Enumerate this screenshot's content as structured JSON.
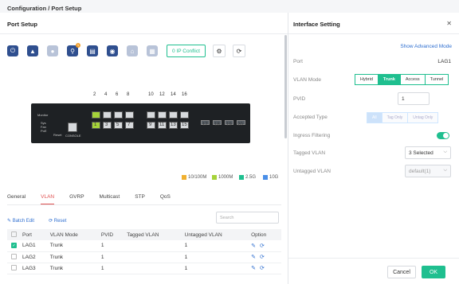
{
  "breadcrumb": {
    "root": "Configuration /",
    "current": "Port Setup"
  },
  "left_panel": {
    "title": "Port Setup",
    "toolbar": {
      "ip_conflict_label": "0 IP Conflict",
      "badge_count": "1"
    },
    "top_port_numbers": [
      "2",
      "4",
      "6",
      "8",
      "10",
      "12",
      "14",
      "16"
    ],
    "bottom_port_numbers": [
      "1",
      "3",
      "5",
      "7",
      "9",
      "11",
      "13",
      "15"
    ],
    "sfp_port_numbers": [
      "17",
      "18",
      "19",
      "20"
    ],
    "device_labels": {
      "monitor": "Monitor",
      "sys": "Sys",
      "fan": "Fan",
      "poe": "PoE",
      "reset": "Reset",
      "console": "CONSOLE"
    },
    "legend": [
      {
        "label": "10/100M",
        "color": "#f0b030"
      },
      {
        "label": "1000M",
        "color": "#a6d33a"
      },
      {
        "label": "2.5G",
        "color": "#1fbf8f"
      },
      {
        "label": "10G",
        "color": "#4a8fe8"
      }
    ],
    "tabs": [
      "General",
      "VLAN",
      "GVRP",
      "Multicast",
      "STP",
      "QoS"
    ],
    "active_tab": "VLAN",
    "search_placeholder": "Search",
    "batch_edit": "Batch Edit",
    "reset": "Reset",
    "table": {
      "headers": [
        "Port",
        "VLAN Mode",
        "PVID",
        "Tagged VLAN",
        "Untagged VLAN",
        "Option"
      ],
      "rows": [
        {
          "port": "LAG1",
          "mode": "Trunk",
          "pvid": "1",
          "tagged": "",
          "untagged": "1",
          "checked": true
        },
        {
          "port": "LAG2",
          "mode": "Trunk",
          "pvid": "1",
          "tagged": "",
          "untagged": "1",
          "checked": false
        },
        {
          "port": "LAG3",
          "mode": "Trunk",
          "pvid": "1",
          "tagged": "",
          "untagged": "1",
          "checked": false
        }
      ]
    }
  },
  "right_panel": {
    "title": "Interface Setting",
    "show_advanced": "Show Advanced Mode",
    "port_label": "Port",
    "port_value": "LAG1",
    "vlan_mode_label": "VLAN Mode",
    "vlan_modes": [
      "Hybrid",
      "Trunk",
      "Access",
      "Tunnel"
    ],
    "vlan_mode_selected": "Trunk",
    "pvid_label": "PVID",
    "pvid_value": "1",
    "accepted_type_label": "Accepted Type",
    "accepted_types": [
      "All",
      "Tag Only",
      "Untag Only"
    ],
    "accepted_selected": "All",
    "ingress_filtering_label": "Ingress Filtering",
    "ingress_filtering_on": true,
    "tagged_vlan_label": "Tagged VLAN",
    "tagged_vlan_value": "3 Selected",
    "untagged_vlan_label": "Untagged VLAN",
    "untagged_vlan_value": "default(1)",
    "cancel": "Cancel",
    "ok": "OK"
  }
}
